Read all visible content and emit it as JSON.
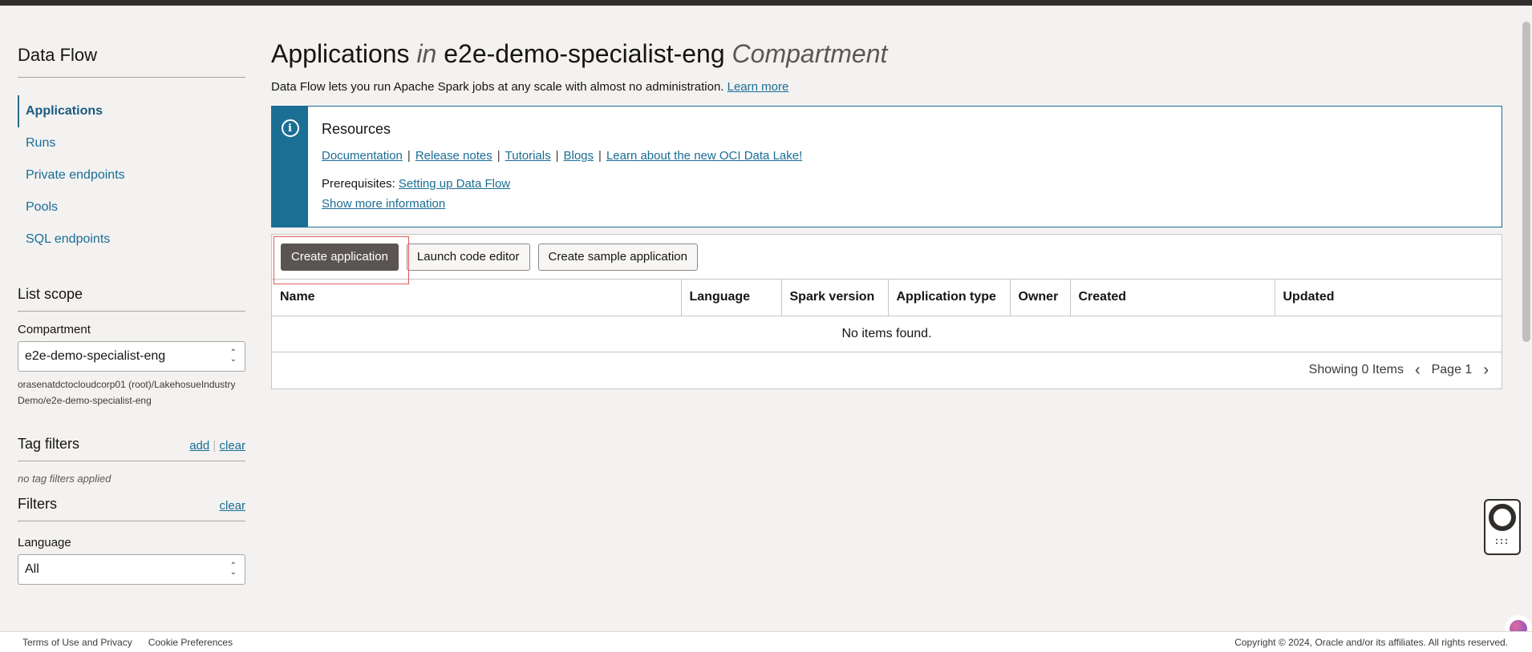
{
  "sidebar": {
    "title": "Data Flow",
    "nav": [
      {
        "label": "Applications"
      },
      {
        "label": "Runs"
      },
      {
        "label": "Private endpoints"
      },
      {
        "label": "Pools"
      },
      {
        "label": "SQL endpoints"
      }
    ],
    "list_scope": {
      "title": "List scope",
      "compartment_label": "Compartment",
      "compartment_value": "e2e-demo-specialist-eng",
      "compartment_path_line1": "orasenatdctocloudcorp01 (root)/LakehosueIndustry",
      "compartment_path_line2": "Demo/e2e-demo-specialist-eng"
    },
    "tag_filters": {
      "title": "Tag filters",
      "add_label": "add",
      "clear_label": "clear",
      "empty_text": "no tag filters applied"
    },
    "filters": {
      "title": "Filters",
      "clear_label": "clear",
      "language_label": "Language",
      "language_value": "All"
    }
  },
  "header": {
    "title_prefix": "Applications",
    "title_in": "in",
    "title_compartment": "e2e-demo-specialist-eng",
    "title_suffix": "Compartment",
    "description": "Data Flow lets you run Apache Spark jobs at any scale with almost no administration.",
    "learn_more": "Learn more"
  },
  "resources": {
    "title": "Resources",
    "links": [
      "Documentation",
      "Release notes",
      "Tutorials",
      "Blogs",
      "Learn about the new OCI Data Lake!"
    ],
    "prereq_label": "Prerequisites:",
    "prereq_link": "Setting up Data Flow",
    "show_more": "Show more information"
  },
  "toolbar": {
    "create_label": "Create application",
    "launch_label": "Launch code editor",
    "sample_label": "Create sample application"
  },
  "table": {
    "columns": [
      "Name",
      "Language",
      "Spark version",
      "Application type",
      "Owner",
      "Created",
      "Updated"
    ],
    "empty_text": "No items found.",
    "showing_text": "Showing 0 Items",
    "page_text": "Page 1"
  },
  "footer": {
    "terms": "Terms of Use and Privacy",
    "cookies": "Cookie Preferences",
    "copyright": "Copyright © 2024, Oracle and/or its affiliates. All rights reserved."
  },
  "colors": {
    "accent": "#1b6f94",
    "primary_button": "#5a5552",
    "highlight_border": "#e05a5a"
  }
}
